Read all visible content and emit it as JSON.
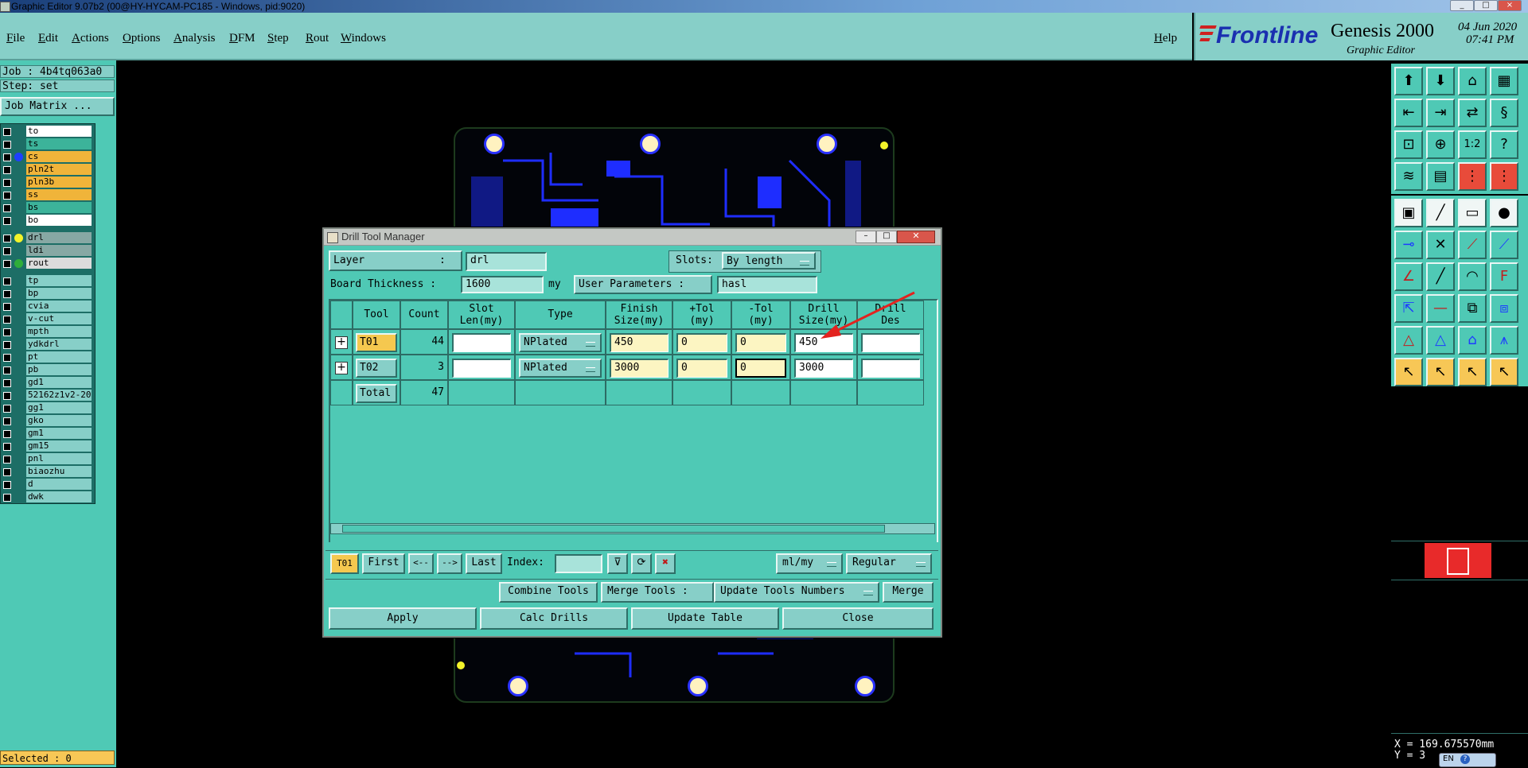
{
  "window": {
    "title": "Graphic Editor 9.07b2 (00@HY-HYCAM-PC185 - Windows, pid:9020)",
    "controls": [
      "_",
      "□",
      "×"
    ]
  },
  "menu": {
    "items": [
      "File",
      "Edit",
      "Actions",
      "Options",
      "Analysis",
      "DFM",
      "Step",
      "Rout",
      "Windows"
    ],
    "help": "Help"
  },
  "branding": {
    "logo": "Frontline",
    "product": "Genesis 2000",
    "subtitle": "Graphic Editor",
    "date": "04 Jun 2020",
    "time": "07:41 PM"
  },
  "job": {
    "job_line": "Job : 4b4tq063a0",
    "step_line": "Step: set",
    "matrix_button": "Job Matrix ..."
  },
  "layers": [
    {
      "name": "to",
      "color": "#ffffff",
      "dot": ""
    },
    {
      "name": "ts",
      "color": "#3cb39a",
      "dot": ""
    },
    {
      "name": "cs",
      "color": "#f0b43a",
      "dot": "#1e40ff"
    },
    {
      "name": "pln2t",
      "color": "#f0b43a",
      "dot": ""
    },
    {
      "name": "pln3b",
      "color": "#f0b43a",
      "dot": ""
    },
    {
      "name": "ss",
      "color": "#f0b43a",
      "dot": ""
    },
    {
      "name": "bs",
      "color": "#3cb39a",
      "dot": ""
    },
    {
      "name": "bo",
      "color": "#ffffff",
      "dot": ""
    },
    {
      "name": "drl",
      "color": "#87a8a4",
      "dot": "#f3f32a"
    },
    {
      "name": "ldi",
      "color": "#87a8a4",
      "dot": ""
    },
    {
      "name": "rout",
      "color": "#dcdcdc",
      "dot": "#2fae3a"
    },
    {
      "name": "tp",
      "color": "#87cfc8",
      "dot": ""
    },
    {
      "name": "bp",
      "color": "#87cfc8",
      "dot": ""
    },
    {
      "name": "cvia",
      "color": "#87cfc8",
      "dot": ""
    },
    {
      "name": "v-cut",
      "color": "#87cfc8",
      "dot": ""
    },
    {
      "name": "mpth",
      "color": "#87cfc8",
      "dot": ""
    },
    {
      "name": "ydkdrl",
      "color": "#87cfc8",
      "dot": ""
    },
    {
      "name": "pt",
      "color": "#87cfc8",
      "dot": ""
    },
    {
      "name": "pb",
      "color": "#87cfc8",
      "dot": ""
    },
    {
      "name": "gd1",
      "color": "#87cfc8",
      "dot": ""
    },
    {
      "name": "52162z1v2-20",
      "color": "#87cfc8",
      "dot": ""
    },
    {
      "name": "gg1",
      "color": "#87cfc8",
      "dot": ""
    },
    {
      "name": "gko",
      "color": "#87cfc8",
      "dot": ""
    },
    {
      "name": "gm1",
      "color": "#87cfc8",
      "dot": ""
    },
    {
      "name": "gm15",
      "color": "#87cfc8",
      "dot": ""
    },
    {
      "name": "pnl",
      "color": "#87cfc8",
      "dot": ""
    },
    {
      "name": "biaozhu",
      "color": "#87cfc8",
      "dot": ""
    },
    {
      "name": "d",
      "color": "#87cfc8",
      "dot": ""
    },
    {
      "name": "dwk",
      "color": "#87cfc8",
      "dot": ""
    }
  ],
  "status": {
    "selected": "Selected : 0",
    "coord_x": "X = 169.675570mm",
    "coord_y": "Y = 3",
    "lang": "EN"
  },
  "dialog": {
    "title": "Drill Tool Manager",
    "layer_label": "Layer            :",
    "layer_value": "drl",
    "slots_label": "Slots:",
    "slots_value": "By length",
    "thickness_label": "Board Thickness :",
    "thickness_value": "1600",
    "thickness_unit": "my",
    "user_params_label": "User Parameters :",
    "user_params_value": "hasl",
    "columns": {
      "tool": "Tool",
      "count": "Count",
      "slot": "Slot\nLen(my)",
      "type": "Type",
      "finish": "Finish\nSize(my)",
      "ptol": "+Tol\n(my)",
      "mtol": "-Tol\n(my)",
      "drill": "Drill\nSize(my)",
      "des": "Drill\nDes"
    },
    "rows": [
      {
        "tool": "T01",
        "count": "44",
        "type": "NPlated",
        "finish": "450",
        "ptol": "0",
        "mtol": "0",
        "drill": "450"
      },
      {
        "tool": "T02",
        "count": "3",
        "type": "NPlated",
        "finish": "3000",
        "ptol": "0",
        "mtol": "0",
        "drill": "3000"
      }
    ],
    "total_label": "Total",
    "total_count": "47",
    "nav": {
      "current": "T01",
      "first": "First",
      "prev": "<--",
      "next": "-->",
      "last": "Last",
      "index_label": "Index:",
      "units": "ml/my",
      "mode": "Regular"
    },
    "merge": {
      "combine": "Combine Tools",
      "merge_label": "Merge Tools :",
      "update_numbers": "Update Tools Numbers",
      "merge": "Merge"
    },
    "actions": {
      "apply": "Apply",
      "calc": "Calc Drills",
      "update": "Update Table",
      "close": "Close"
    }
  }
}
